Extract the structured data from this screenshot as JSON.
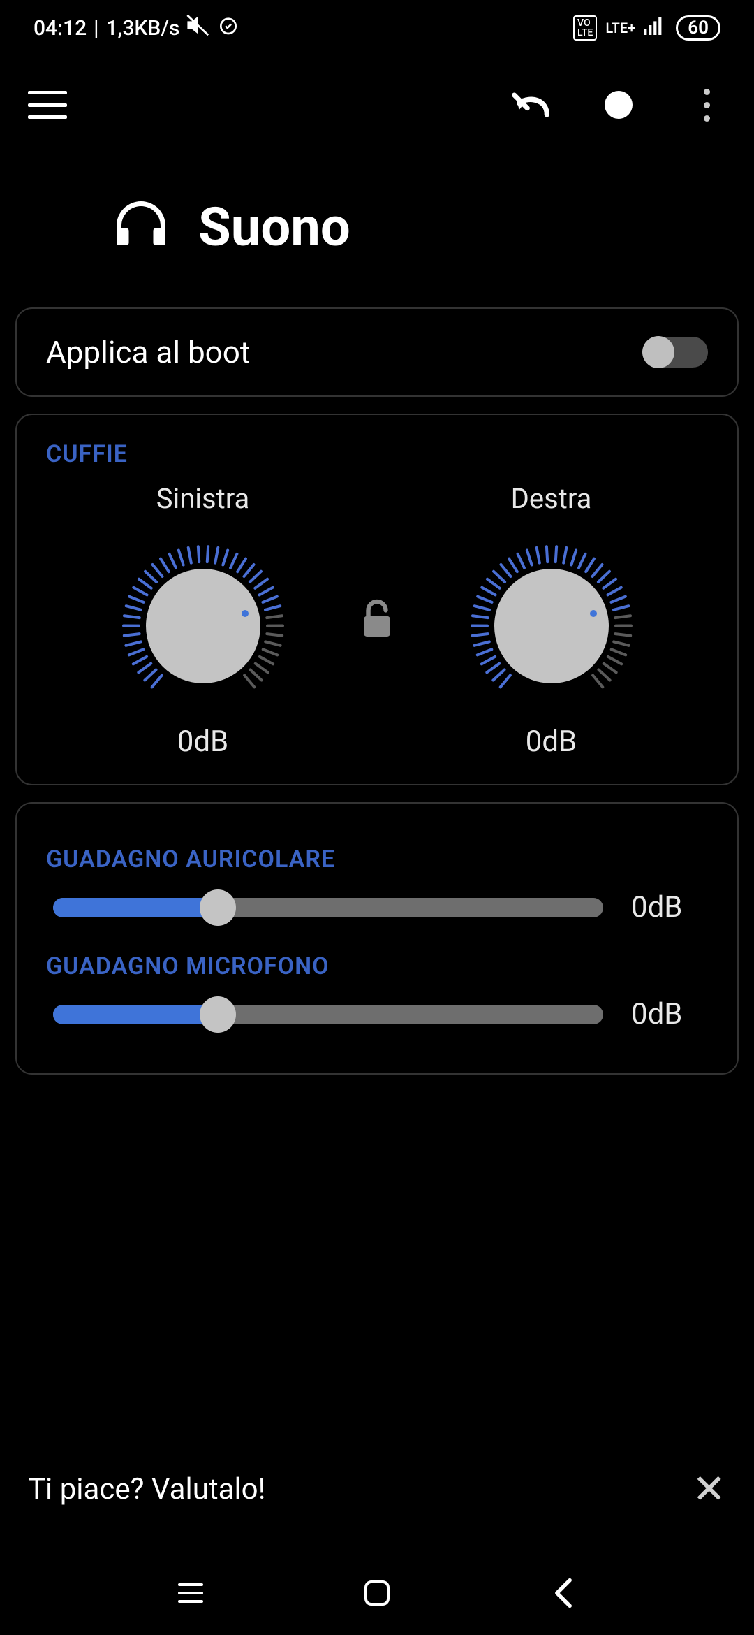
{
  "status": {
    "time": "04:12",
    "speed": "1,3KB/s",
    "volte": "VoLTE",
    "network": "LTE+",
    "battery": "60"
  },
  "page": {
    "title": "Suono"
  },
  "boot": {
    "label": "Applica al boot",
    "enabled": false
  },
  "cuffie": {
    "heading": "CUFFIE",
    "left_label": "Sinistra",
    "right_label": "Destra",
    "left_value": "0dB",
    "right_value": "0dB",
    "locked": false
  },
  "gains": {
    "auricolare_heading": "GUADAGNO AURICOLARE",
    "auricolare_value": "0dB",
    "auricolare_percent": 30,
    "microfono_heading": "GUADAGNO MICROFONO",
    "microfono_value": "0dB",
    "microfono_percent": 30
  },
  "banner": {
    "text": "Ti piace? Valutalo!"
  }
}
